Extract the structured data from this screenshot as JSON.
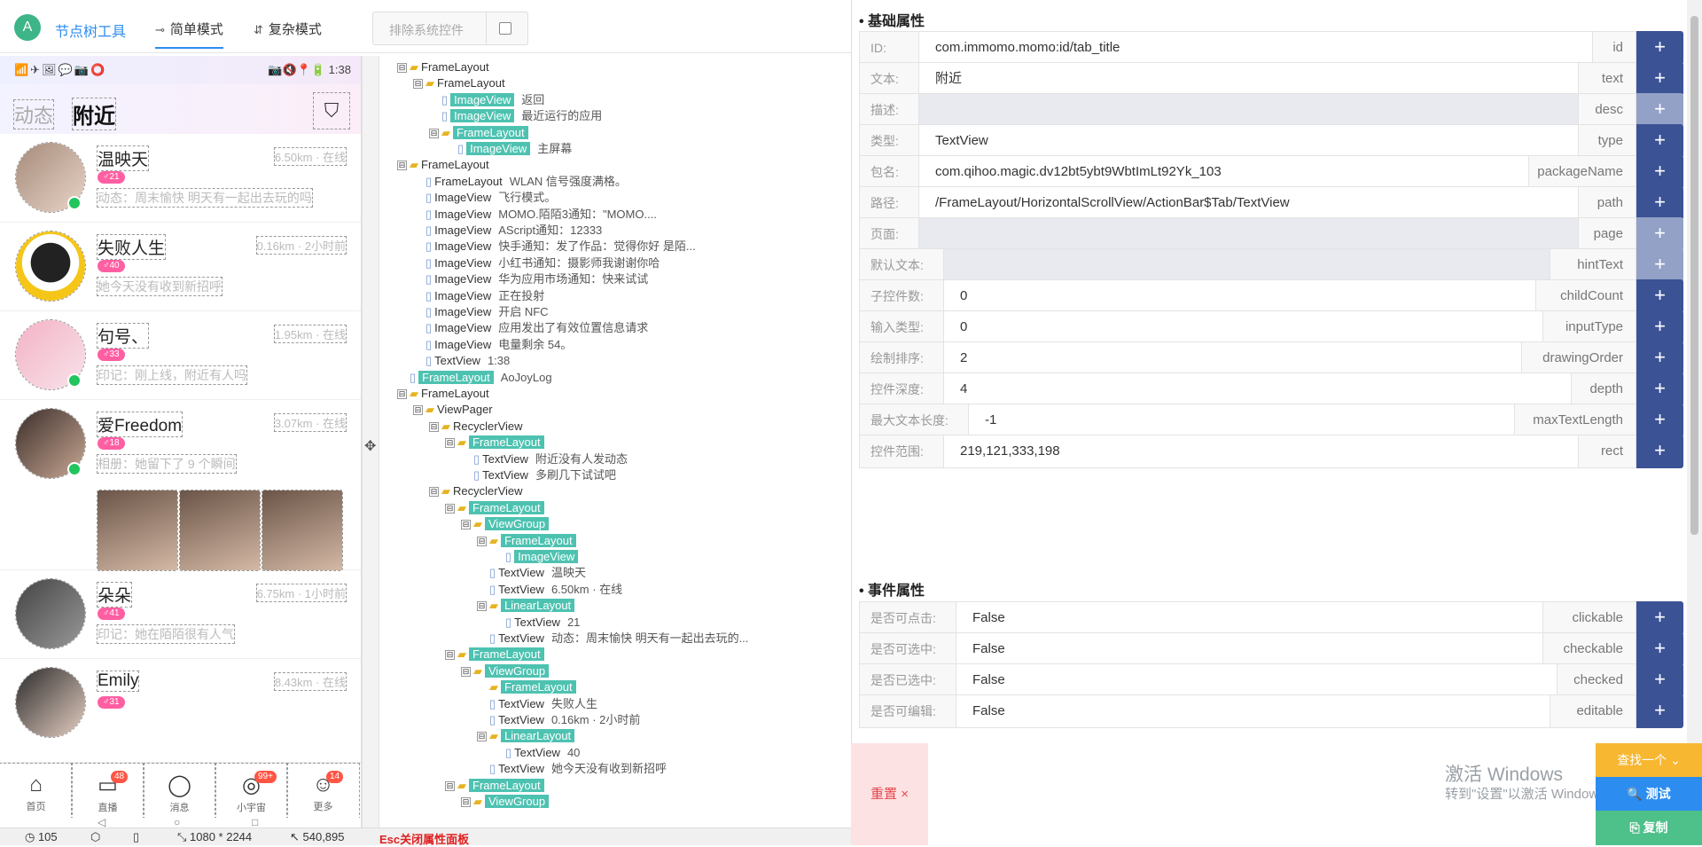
{
  "app": {
    "logo": "A",
    "title": "节点树工具"
  },
  "modes": [
    {
      "icon": "simple-mode-icon",
      "label": "简单模式",
      "active": true
    },
    {
      "icon": "complex-mode-icon",
      "label": "复杂模式",
      "active": false
    }
  ],
  "exclude": {
    "label": "排除系统控件"
  },
  "phone": {
    "status_icons": "📶✈🖼💬📷⭕",
    "status_right": "📷🔇📍🔋 1:38",
    "tab_dongtai": "动态",
    "tab_fujin": "附近",
    "users": [
      {
        "name": "温映天",
        "level": "♂21",
        "dist": "6.50km · 在线",
        "sub": "动态：周末愉快 明天有一起出去玩的吗",
        "online": true
      },
      {
        "name": "失败人生",
        "level": "♂40",
        "dist": "0.16km · 2小时前",
        "sub": "她今天没有收到新招呼",
        "online": false
      },
      {
        "name": "句号、",
        "level": "♂33",
        "dist": "1.95km · 在线",
        "sub": "印记：刚上线，附近有人吗",
        "online": true
      },
      {
        "name": "爱Freedom",
        "level": "♂18",
        "dist": "3.07km · 在线",
        "sub": "相册：她留下了 9 个瞬间",
        "online": true
      },
      {
        "name": "朵朵",
        "level": "♂41",
        "dist": "6.75km · 1小时前",
        "sub": "印记：她在陌陌很有人气",
        "online": false
      },
      {
        "name": "Emily",
        "level": "♂31",
        "dist": "8.43km · 在线",
        "sub": "",
        "online": false
      }
    ],
    "nav": [
      {
        "label": "首页",
        "icon": "home-icon",
        "badge": ""
      },
      {
        "label": "直播",
        "icon": "live-icon",
        "badge": "48"
      },
      {
        "label": "消息",
        "icon": "message-icon",
        "badge": ""
      },
      {
        "label": "小宇宙",
        "icon": "planet-icon",
        "badge": "99+"
      },
      {
        "label": "更多",
        "icon": "more-icon",
        "badge": "14"
      }
    ]
  },
  "tree": [
    {
      "d": 0,
      "toggle": "⊟",
      "type": "folder",
      "label": "FrameLayout",
      "text": "",
      "hl": false
    },
    {
      "d": 1,
      "toggle": "⊟",
      "type": "folder",
      "label": "FrameLayout",
      "text": "",
      "hl": false
    },
    {
      "d": 2,
      "toggle": "",
      "type": "file",
      "label": "ImageView",
      "text": "返回",
      "hl": true
    },
    {
      "d": 2,
      "toggle": "",
      "type": "file",
      "label": "ImageView",
      "text": "最近运行的应用",
      "hl": true
    },
    {
      "d": 2,
      "toggle": "⊟",
      "type": "folder",
      "label": "FrameLayout",
      "text": "",
      "hl": true
    },
    {
      "d": 3,
      "toggle": "",
      "type": "file",
      "label": "ImageView",
      "text": "主屏幕",
      "hl": true
    },
    {
      "d": 0,
      "toggle": "⊟",
      "type": "folder",
      "label": "FrameLayout",
      "text": "",
      "hl": false
    },
    {
      "d": 1,
      "toggle": "",
      "type": "file",
      "label": "FrameLayout",
      "text": "WLAN 信号强度满格。",
      "hl": false
    },
    {
      "d": 1,
      "toggle": "",
      "type": "file",
      "label": "ImageView",
      "text": "飞行模式。",
      "hl": false
    },
    {
      "d": 1,
      "toggle": "",
      "type": "file",
      "label": "ImageView",
      "text": "MOMO.陌陌3通知：\"MOMO....",
      "hl": false
    },
    {
      "d": 1,
      "toggle": "",
      "type": "file",
      "label": "ImageView",
      "text": "AScript通知：12333",
      "hl": false
    },
    {
      "d": 1,
      "toggle": "",
      "type": "file",
      "label": "ImageView",
      "text": "快手通知：发了作品：觉得你好 是陌...",
      "hl": false
    },
    {
      "d": 1,
      "toggle": "",
      "type": "file",
      "label": "ImageView",
      "text": "小红书通知：摄影师我谢谢你哈",
      "hl": false
    },
    {
      "d": 1,
      "toggle": "",
      "type": "file",
      "label": "ImageView",
      "text": "华为应用市场通知：快来试试",
      "hl": false
    },
    {
      "d": 1,
      "toggle": "",
      "type": "file",
      "label": "ImageView",
      "text": "正在投射",
      "hl": false
    },
    {
      "d": 1,
      "toggle": "",
      "type": "file",
      "label": "ImageView",
      "text": "开启 NFC",
      "hl": false
    },
    {
      "d": 1,
      "toggle": "",
      "type": "file",
      "label": "ImageView",
      "text": "应用发出了有效位置信息请求",
      "hl": false
    },
    {
      "d": 1,
      "toggle": "",
      "type": "file",
      "label": "ImageView",
      "text": "电量剩余 54。",
      "hl": false
    },
    {
      "d": 1,
      "toggle": "",
      "type": "file",
      "label": "TextView",
      "text": "1:38",
      "hl": false
    },
    {
      "d": 0,
      "toggle": "",
      "type": "file",
      "label": "FrameLayout",
      "text": "AoJoyLog",
      "hl": true
    },
    {
      "d": 0,
      "toggle": "⊟",
      "type": "folder",
      "label": "FrameLayout",
      "text": "",
      "hl": false
    },
    {
      "d": 1,
      "toggle": "⊟",
      "type": "folder",
      "label": "ViewPager",
      "text": "",
      "hl": false
    },
    {
      "d": 2,
      "toggle": "⊟",
      "type": "folder",
      "label": "RecyclerView",
      "text": "",
      "hl": false
    },
    {
      "d": 3,
      "toggle": "⊟",
      "type": "folder",
      "label": "FrameLayout",
      "text": "",
      "hl": true
    },
    {
      "d": 4,
      "toggle": "",
      "type": "file",
      "label": "TextView",
      "text": "附近没有人发动态",
      "hl": false
    },
    {
      "d": 4,
      "toggle": "",
      "type": "file",
      "label": "TextView",
      "text": "多刷几下试试吧",
      "hl": false
    },
    {
      "d": 2,
      "toggle": "⊟",
      "type": "folder",
      "label": "RecyclerView",
      "text": "",
      "hl": false
    },
    {
      "d": 3,
      "toggle": "⊟",
      "type": "folder",
      "label": "FrameLayout",
      "text": "",
      "hl": true
    },
    {
      "d": 4,
      "toggle": "⊟",
      "type": "folder",
      "label": "ViewGroup",
      "text": "",
      "hl": true
    },
    {
      "d": 5,
      "toggle": "⊟",
      "type": "folder",
      "label": "FrameLayout",
      "text": "",
      "hl": true
    },
    {
      "d": 6,
      "toggle": "",
      "type": "file",
      "label": "ImageView",
      "text": "",
      "hl": true
    },
    {
      "d": 5,
      "toggle": "",
      "type": "file",
      "label": "TextView",
      "text": "温映天",
      "hl": false
    },
    {
      "d": 5,
      "toggle": "",
      "type": "file",
      "label": "TextView",
      "text": "6.50km · 在线",
      "hl": false
    },
    {
      "d": 5,
      "toggle": "⊟",
      "type": "folder",
      "label": "LinearLayout",
      "text": "",
      "hl": true
    },
    {
      "d": 6,
      "toggle": "",
      "type": "file",
      "label": "TextView",
      "text": "21",
      "hl": false
    },
    {
      "d": 5,
      "toggle": "",
      "type": "file",
      "label": "TextView",
      "text": "动态：周末愉快 明天有一起出去玩的...",
      "hl": false
    },
    {
      "d": 3,
      "toggle": "⊟",
      "type": "folder",
      "label": "FrameLayout",
      "text": "",
      "hl": true
    },
    {
      "d": 4,
      "toggle": "⊟",
      "type": "folder",
      "label": "ViewGroup",
      "text": "",
      "hl": true
    },
    {
      "d": 5,
      "toggle": "",
      "type": "folder",
      "label": "FrameLayout",
      "text": "",
      "hl": true
    },
    {
      "d": 5,
      "toggle": "",
      "type": "file",
      "label": "TextView",
      "text": "失败人生",
      "hl": false
    },
    {
      "d": 5,
      "toggle": "",
      "type": "file",
      "label": "TextView",
      "text": "0.16km · 2小时前",
      "hl": false
    },
    {
      "d": 5,
      "toggle": "⊟",
      "type": "folder",
      "label": "LinearLayout",
      "text": "",
      "hl": true
    },
    {
      "d": 6,
      "toggle": "",
      "type": "file",
      "label": "TextView",
      "text": "40",
      "hl": false
    },
    {
      "d": 5,
      "toggle": "",
      "type": "file",
      "label": "TextView",
      "text": "她今天没有收到新招呼",
      "hl": false
    },
    {
      "d": 3,
      "toggle": "⊟",
      "type": "folder",
      "label": "FrameLayout",
      "text": "",
      "hl": true
    },
    {
      "d": 4,
      "toggle": "⊟",
      "type": "folder",
      "label": "ViewGroup",
      "text": "",
      "hl": true
    }
  ],
  "props": {
    "section_basic": "• 基础属性",
    "section_event": "• 事件属性",
    "basic": [
      {
        "label": "ID:",
        "value": "com.immomo.momo:id/tab_title",
        "key": "id",
        "empty": false
      },
      {
        "label": "文本:",
        "value": "附近",
        "key": "text",
        "empty": false
      },
      {
        "label": "描述:",
        "value": "",
        "key": "desc",
        "empty": true
      },
      {
        "label": "类型:",
        "value": "TextView",
        "key": "type",
        "empty": false
      },
      {
        "label": "包名:",
        "value": "com.qihoo.magic.dv12bt5ybt9WbtImLt92Yk_103",
        "key": "packageName",
        "empty": false
      },
      {
        "label": "路径:",
        "value": "/FrameLayout/HorizontalScrollView/ActionBar$Tab/TextView",
        "key": "path",
        "empty": false
      },
      {
        "label": "页面:",
        "value": "",
        "key": "page",
        "empty": true
      },
      {
        "label": "默认文本:",
        "value": "",
        "key": "hintText",
        "empty": true
      },
      {
        "label": "子控件数:",
        "value": "0",
        "key": "childCount",
        "empty": false
      },
      {
        "label": "输入类型:",
        "value": "0",
        "key": "inputType",
        "empty": false
      },
      {
        "label": "绘制排序:",
        "value": "2",
        "key": "drawingOrder",
        "empty": false
      },
      {
        "label": "控件深度:",
        "value": "4",
        "key": "depth",
        "empty": false
      },
      {
        "label": "最大文本长度:",
        "value": "-1",
        "key": "maxTextLength",
        "empty": false
      },
      {
        "label": "控件范围:",
        "value": "219,121,333,198",
        "key": "rect",
        "empty": false
      }
    ],
    "event": [
      {
        "label": "是否可点击:",
        "value": "False",
        "key": "clickable"
      },
      {
        "label": "是否可选中:",
        "value": "False",
        "key": "checkable"
      },
      {
        "label": "是否已选中:",
        "value": "False",
        "key": "checked"
      },
      {
        "label": "是否可编辑:",
        "value": "False",
        "key": "editable"
      }
    ],
    "plus": "+"
  },
  "actions": {
    "reset": "重置 ×",
    "find": "查找一个 ⌄",
    "test": "🔍 测试",
    "copy": "⎘ 复制",
    "watermark1": "激活 Windows",
    "watermark2": "转到\"设置\"以激活 Windows。"
  },
  "footer": {
    "count": "◷ 105",
    "cube": "⬡",
    "phone": "▯",
    "resolution": "⤡ 1080 * 2244",
    "cursor": "↖ 540,895",
    "esc": "Esc关闭属性面板"
  }
}
